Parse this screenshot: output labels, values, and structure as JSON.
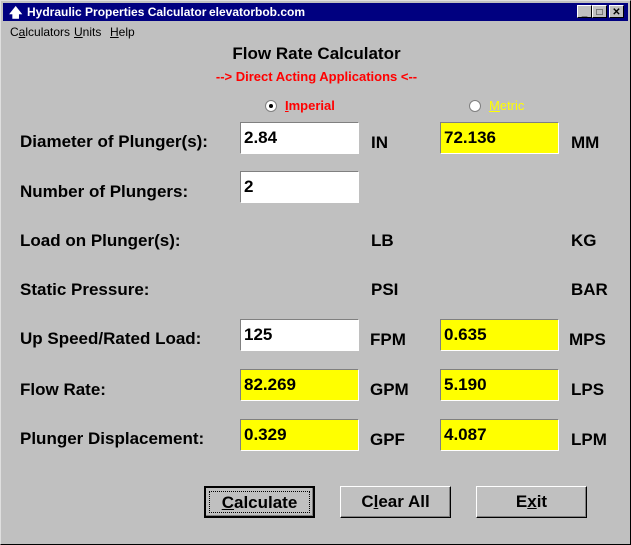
{
  "window": {
    "title": "Hydraulic Properties Calculator",
    "site": "elevatorbob.com",
    "icon": "arrow-up-icon",
    "controls": {
      "minimize": "_",
      "maximize": "□",
      "close": "✕"
    }
  },
  "menu": {
    "items": [
      {
        "pre": "C",
        "acc": "a",
        "post": "lculators"
      },
      {
        "pre": "",
        "acc": "U",
        "post": "nits"
      },
      {
        "pre": "",
        "acc": "H",
        "post": "elp"
      }
    ]
  },
  "header": {
    "title": "Flow Rate Calculator",
    "subtitle": "--> Direct Acting Applications <--"
  },
  "units_mode": {
    "imperial": {
      "acc": "I",
      "rest": "mperial",
      "selected": true,
      "color": "#ff0000"
    },
    "metric": {
      "acc": "M",
      "rest": "etric",
      "selected": false,
      "color": "#ffff00"
    }
  },
  "rows": [
    {
      "label": "Diameter of Plunger(s):",
      "imperial_value": "2.84",
      "imperial_unit": "IN",
      "metric_value": "72.136",
      "metric_unit": "MM"
    },
    {
      "label": "Number of Plungers:",
      "imperial_value": "2"
    },
    {
      "label": "Load on Plunger(s):",
      "imperial_unit": "LB",
      "metric_unit": "KG"
    },
    {
      "label": "Static Pressure:",
      "imperial_unit": "PSI",
      "metric_unit": "BAR"
    },
    {
      "label": "Up Speed/Rated Load:",
      "imperial_value": "125",
      "imperial_unit": "FPM",
      "metric_value": "0.635",
      "metric_unit": "MPS"
    },
    {
      "label": "Flow Rate:",
      "imperial_value": "82.269",
      "imperial_unit": "GPM",
      "metric_value": "5.190",
      "metric_unit": "LPS"
    },
    {
      "label": "Plunger Displacement:",
      "imperial_value": "0.329",
      "imperial_unit": "GPF",
      "metric_value": "4.087",
      "metric_unit": "LPM"
    }
  ],
  "buttons": {
    "calculate": {
      "acc": "C",
      "rest": "alculate"
    },
    "clear": {
      "pre": "C",
      "acc": "l",
      "rest": "ear All"
    },
    "exit": {
      "pre": "E",
      "acc": "x",
      "rest": "it"
    }
  },
  "colors": {
    "titlebar": "#000080",
    "output_field": "#ffff00",
    "input_field": "#ffffff",
    "subtitle": "#ff0000"
  }
}
